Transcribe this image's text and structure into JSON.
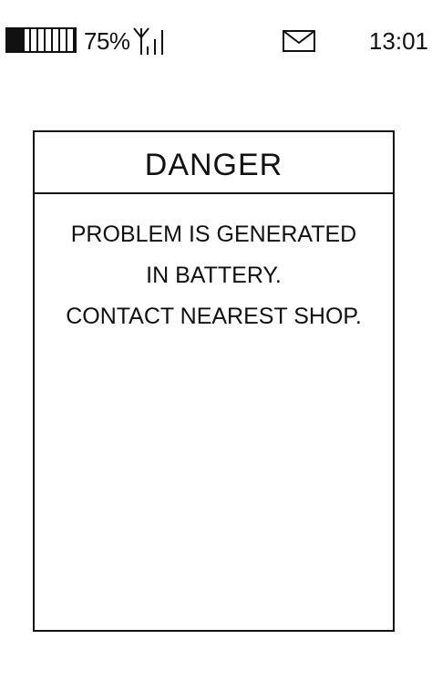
{
  "status_bar": {
    "battery_percent": "75%",
    "battery_level": 0.75,
    "time": "13:01",
    "icons": {
      "battery": "battery-icon",
      "signal": "signal-strength-icon",
      "mail": "mail-icon"
    }
  },
  "dialog": {
    "title": "DANGER",
    "lines": [
      "PROBLEM IS GENERATED",
      "IN BATTERY.",
      "CONTACT NEAREST SHOP."
    ]
  }
}
